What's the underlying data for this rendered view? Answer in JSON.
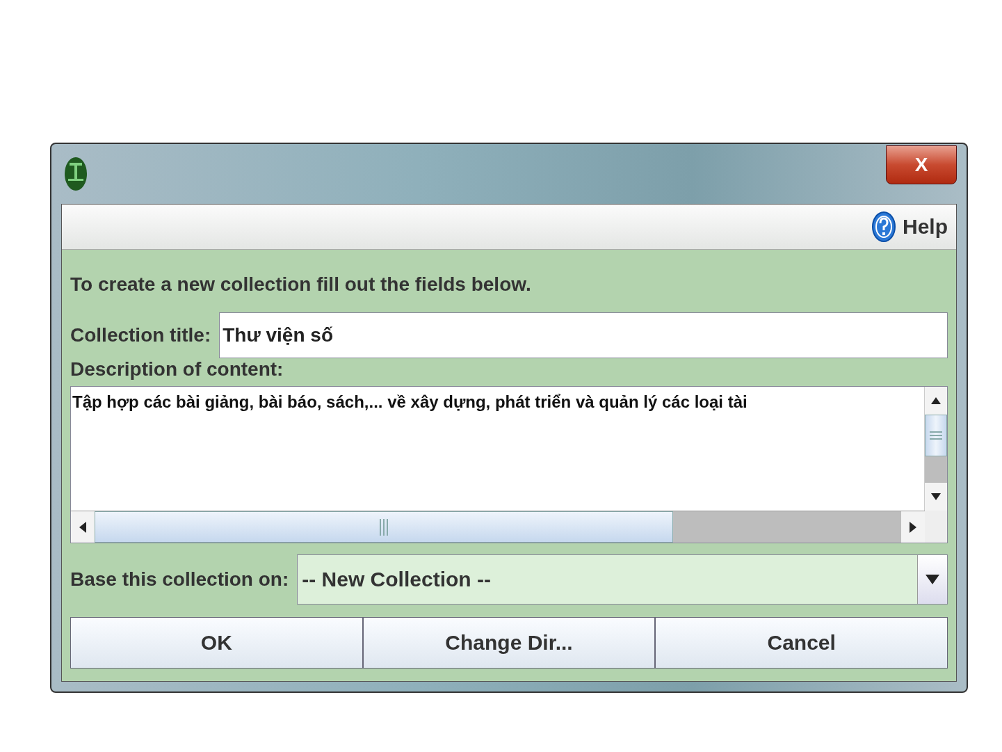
{
  "window": {
    "close_label": "X"
  },
  "toolbar": {
    "help": "Help"
  },
  "form": {
    "instructions": "To create a new collection fill out the fields below.",
    "title_label": "Collection title:",
    "title_value": "Thư viện số",
    "description_label": "Description of content:",
    "description_value": "Tập hợp các bài giảng, bài báo, sách,... về xây dựng, phát triển và quản lý các loại tài",
    "base_label": "Base this collection on:",
    "base_value": "-- New Collection --"
  },
  "buttons": [
    "OK",
    "Change Dir...",
    "Cancel"
  ]
}
